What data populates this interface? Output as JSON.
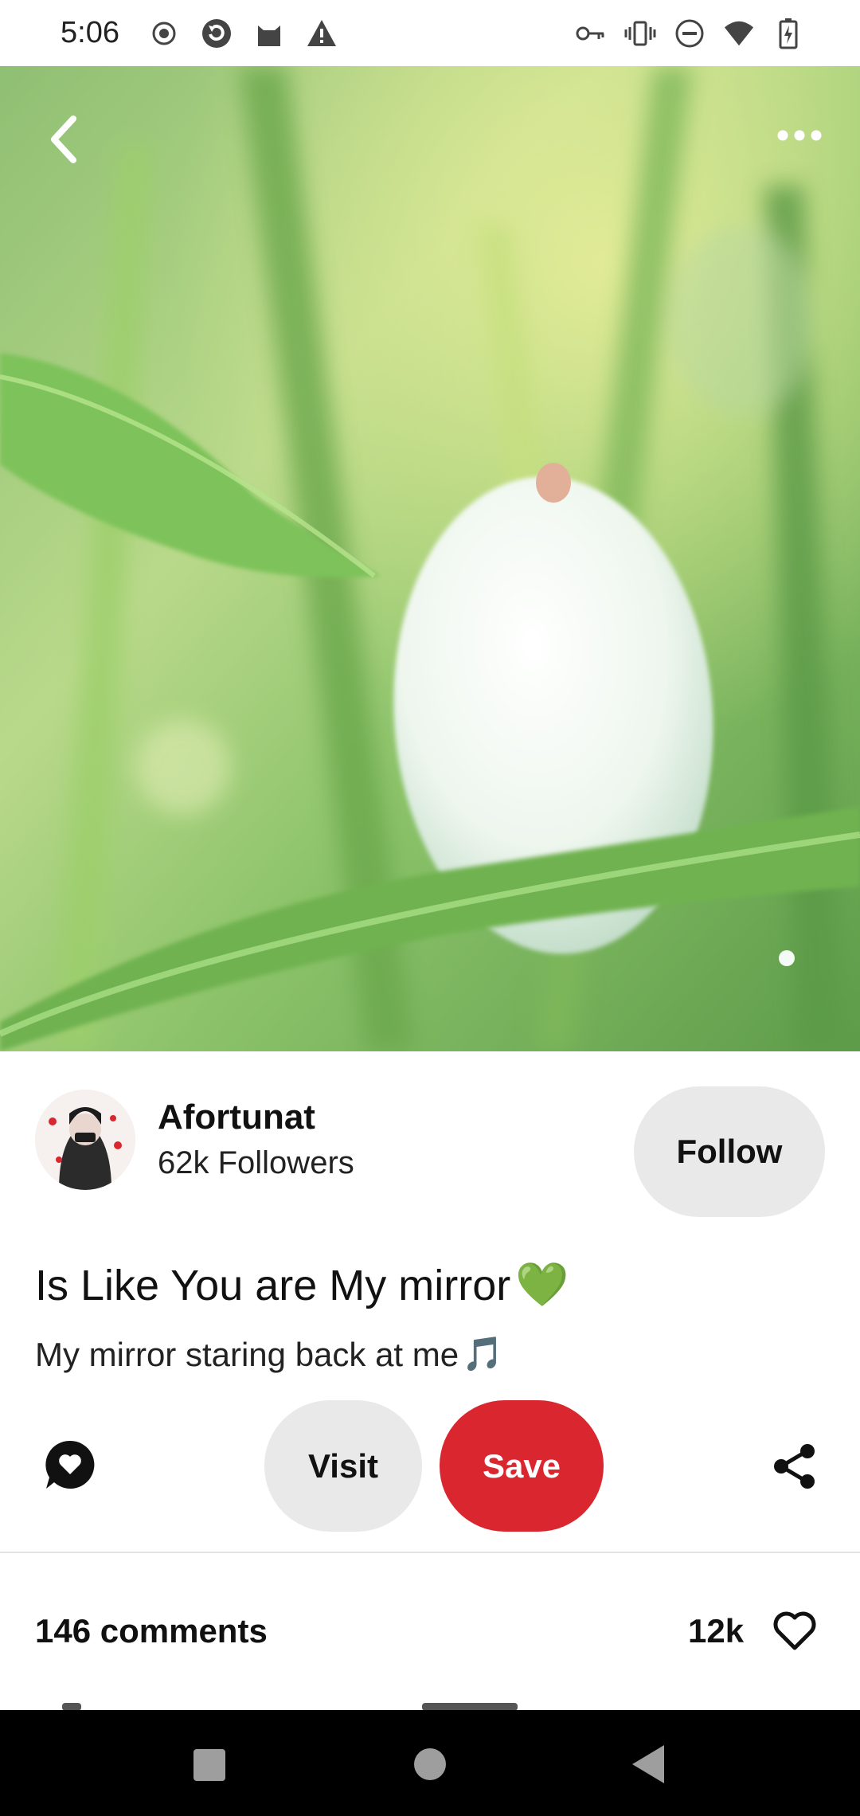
{
  "status_bar": {
    "time": "5:06",
    "left_icons": [
      "record-icon",
      "app-refresh-icon",
      "cat-icon",
      "warning-icon"
    ],
    "right_icons": [
      "vpn-key-icon",
      "vibrate-icon",
      "do-not-disturb-icon",
      "wifi-icon",
      "battery-charging-icon"
    ]
  },
  "pin": {
    "image_description_icon": "hero-image",
    "title": "Is Like You are My mirror",
    "title_emoji": "💚",
    "description": "My mirror staring back at me",
    "description_emoji": "🎵"
  },
  "creator": {
    "name": "Afortunat",
    "followers": "62k Followers",
    "follow_label": "Follow"
  },
  "actions": {
    "visit_label": "Visit",
    "save_label": "Save"
  },
  "engagement": {
    "comments": "146 comments",
    "likes": "12k"
  },
  "colors": {
    "save_button": "#d9262f",
    "secondary_button": "#e9e9e9",
    "nav_bar": "#000000"
  }
}
